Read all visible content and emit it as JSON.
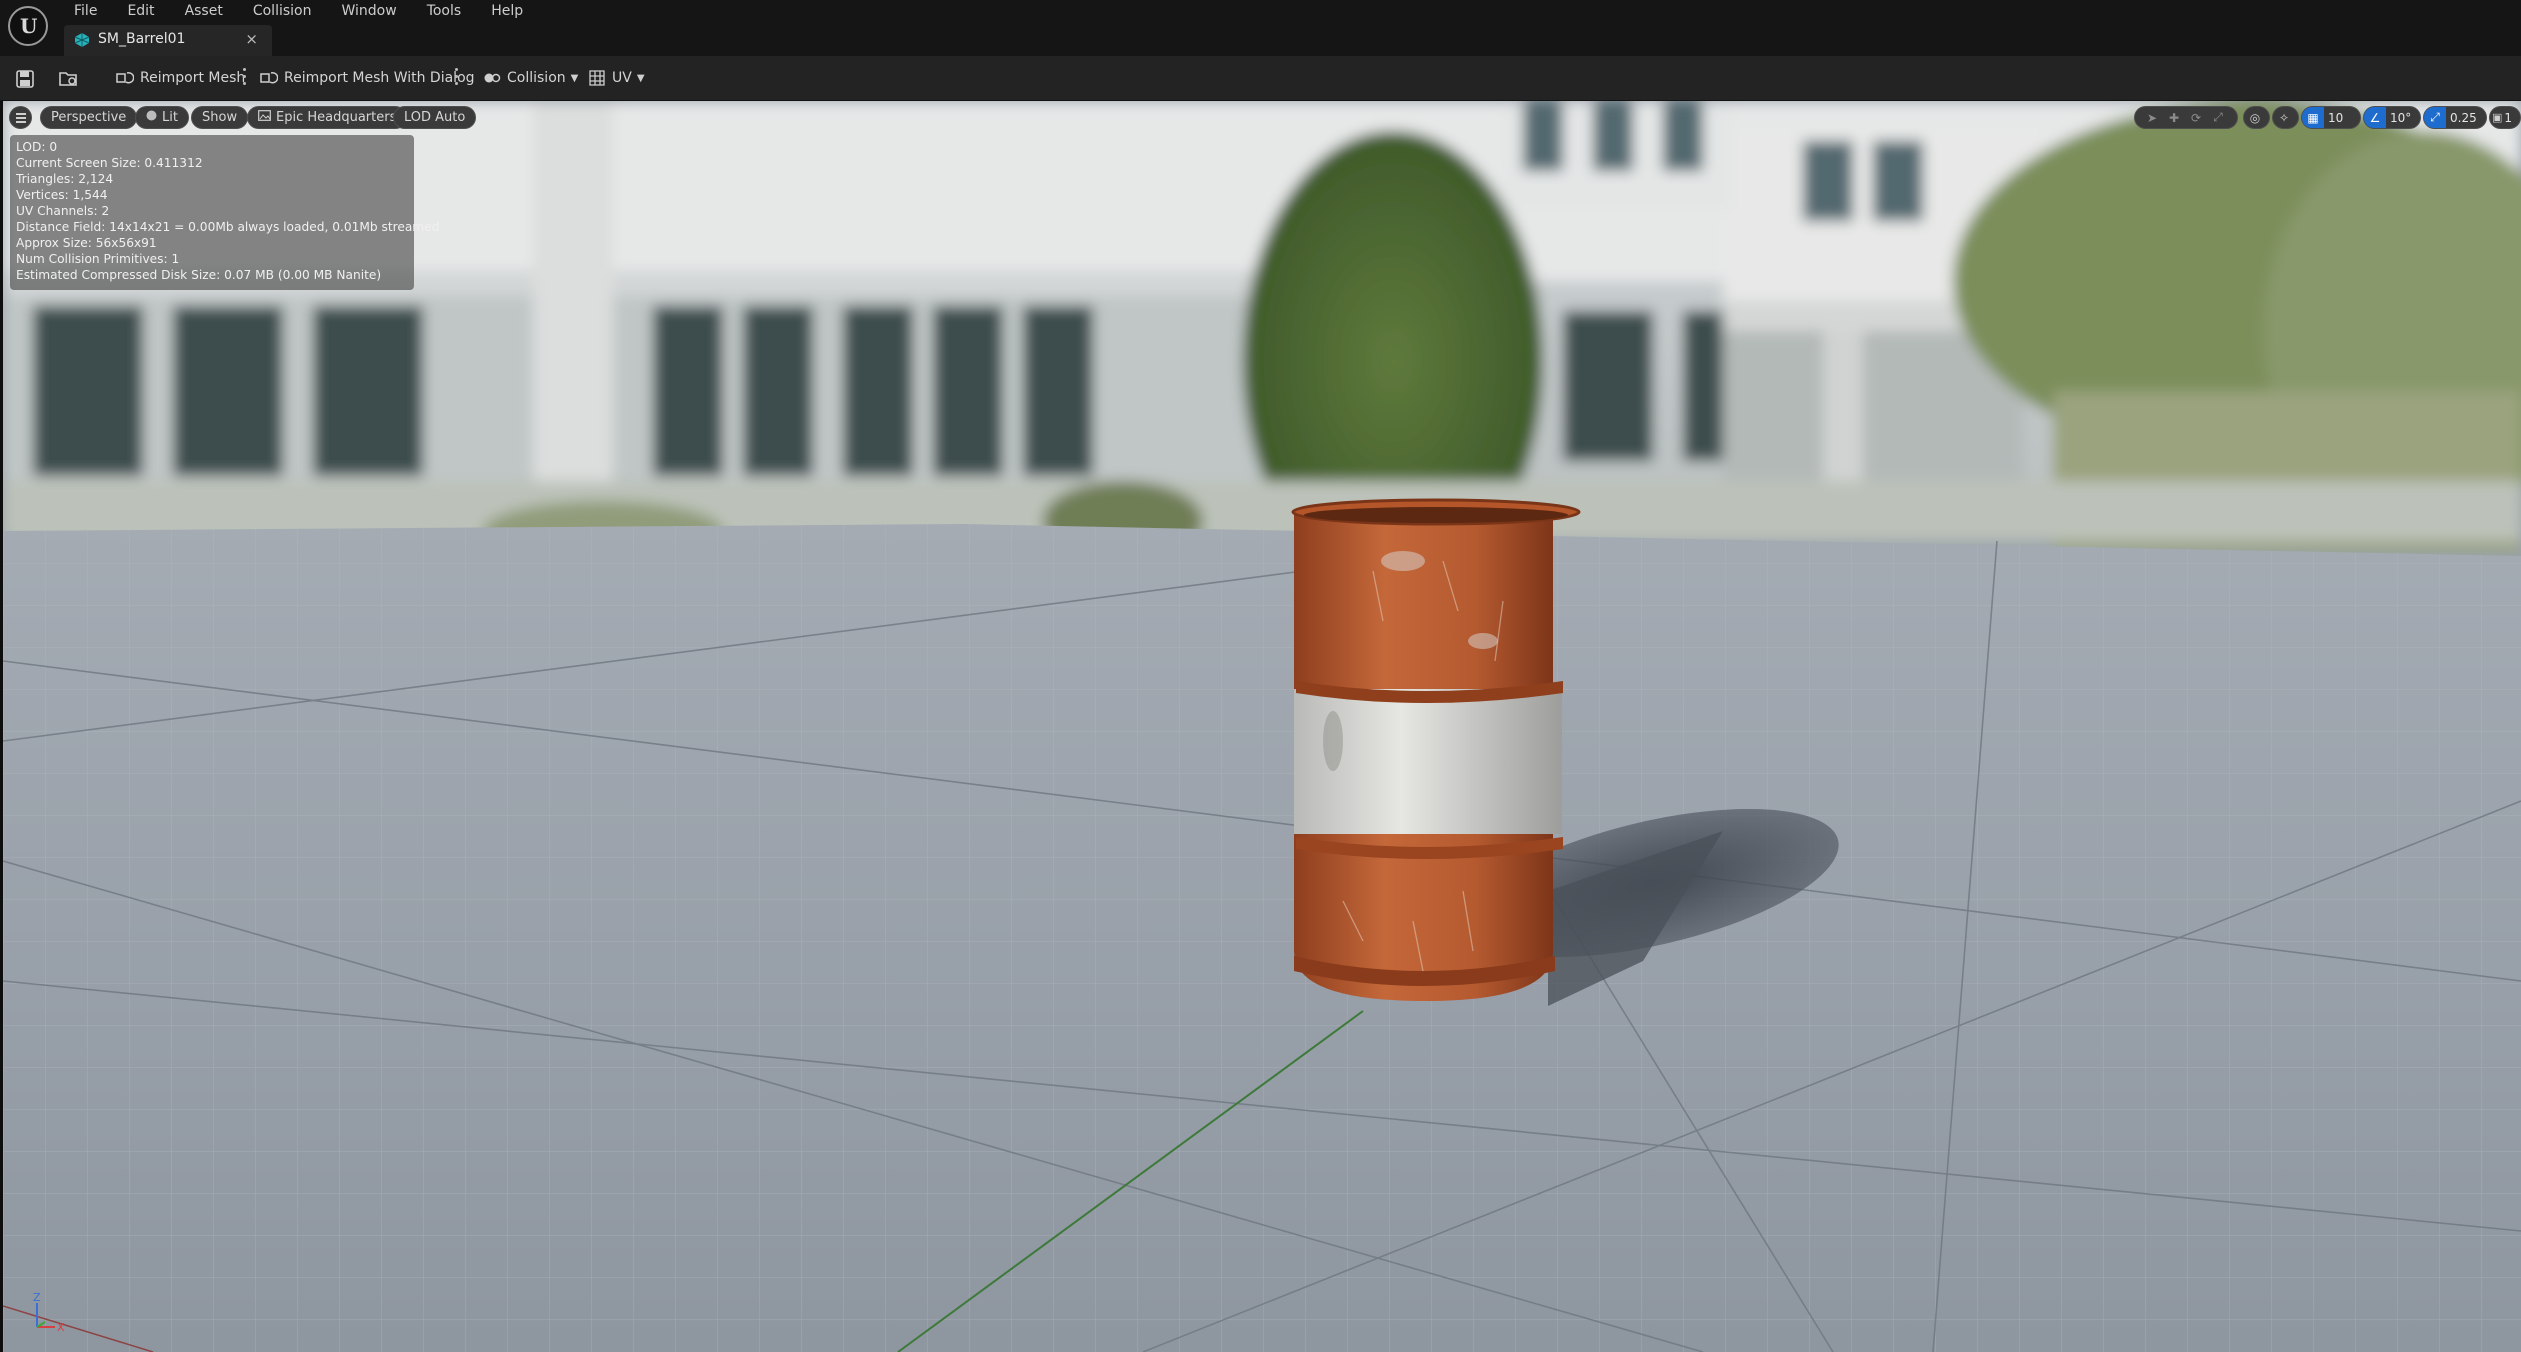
{
  "menu": [
    "File",
    "Edit",
    "Asset",
    "Collision",
    "Window",
    "Tools",
    "Help"
  ],
  "tab": {
    "label": "SM_Barrel01",
    "close": "×"
  },
  "toolbar": {
    "reimport_mesh": "Reimport Mesh",
    "reimport_with_dialog": "Reimport Mesh With Dialog",
    "collision": "Collision",
    "uv": "UV"
  },
  "viewport": {
    "view_mode": "Perspective",
    "lighting": "Lit",
    "show": "Show",
    "environment": "Epic Headquarters",
    "lod": "LOD Auto",
    "grid_snap": "10",
    "rotation_snap": "10°",
    "scale_snap": "0.25",
    "camera_speed": "1",
    "axis_labels": {
      "z": "Z",
      "x": "X"
    }
  },
  "stats": [
    "LOD: 0",
    "Current Screen Size: 0.411312",
    "Triangles: 2,124",
    "Vertices: 1,544",
    "UV Channels: 2",
    "Distance Field: 14x14x21 = 0.00Mb always loaded, 0.01Mb streamed",
    "Approx Size: 56x56x91",
    "Num Collision Primitives: 1",
    "Estimated Compressed Disk Size: 0.07 MB (0.00 MB Nanite)"
  ],
  "colors": {
    "accent": "#1f6ccf",
    "barrel_orange": "#b65a2e",
    "barrel_white": "#d8d8d8",
    "floor": "#98a0a9"
  }
}
